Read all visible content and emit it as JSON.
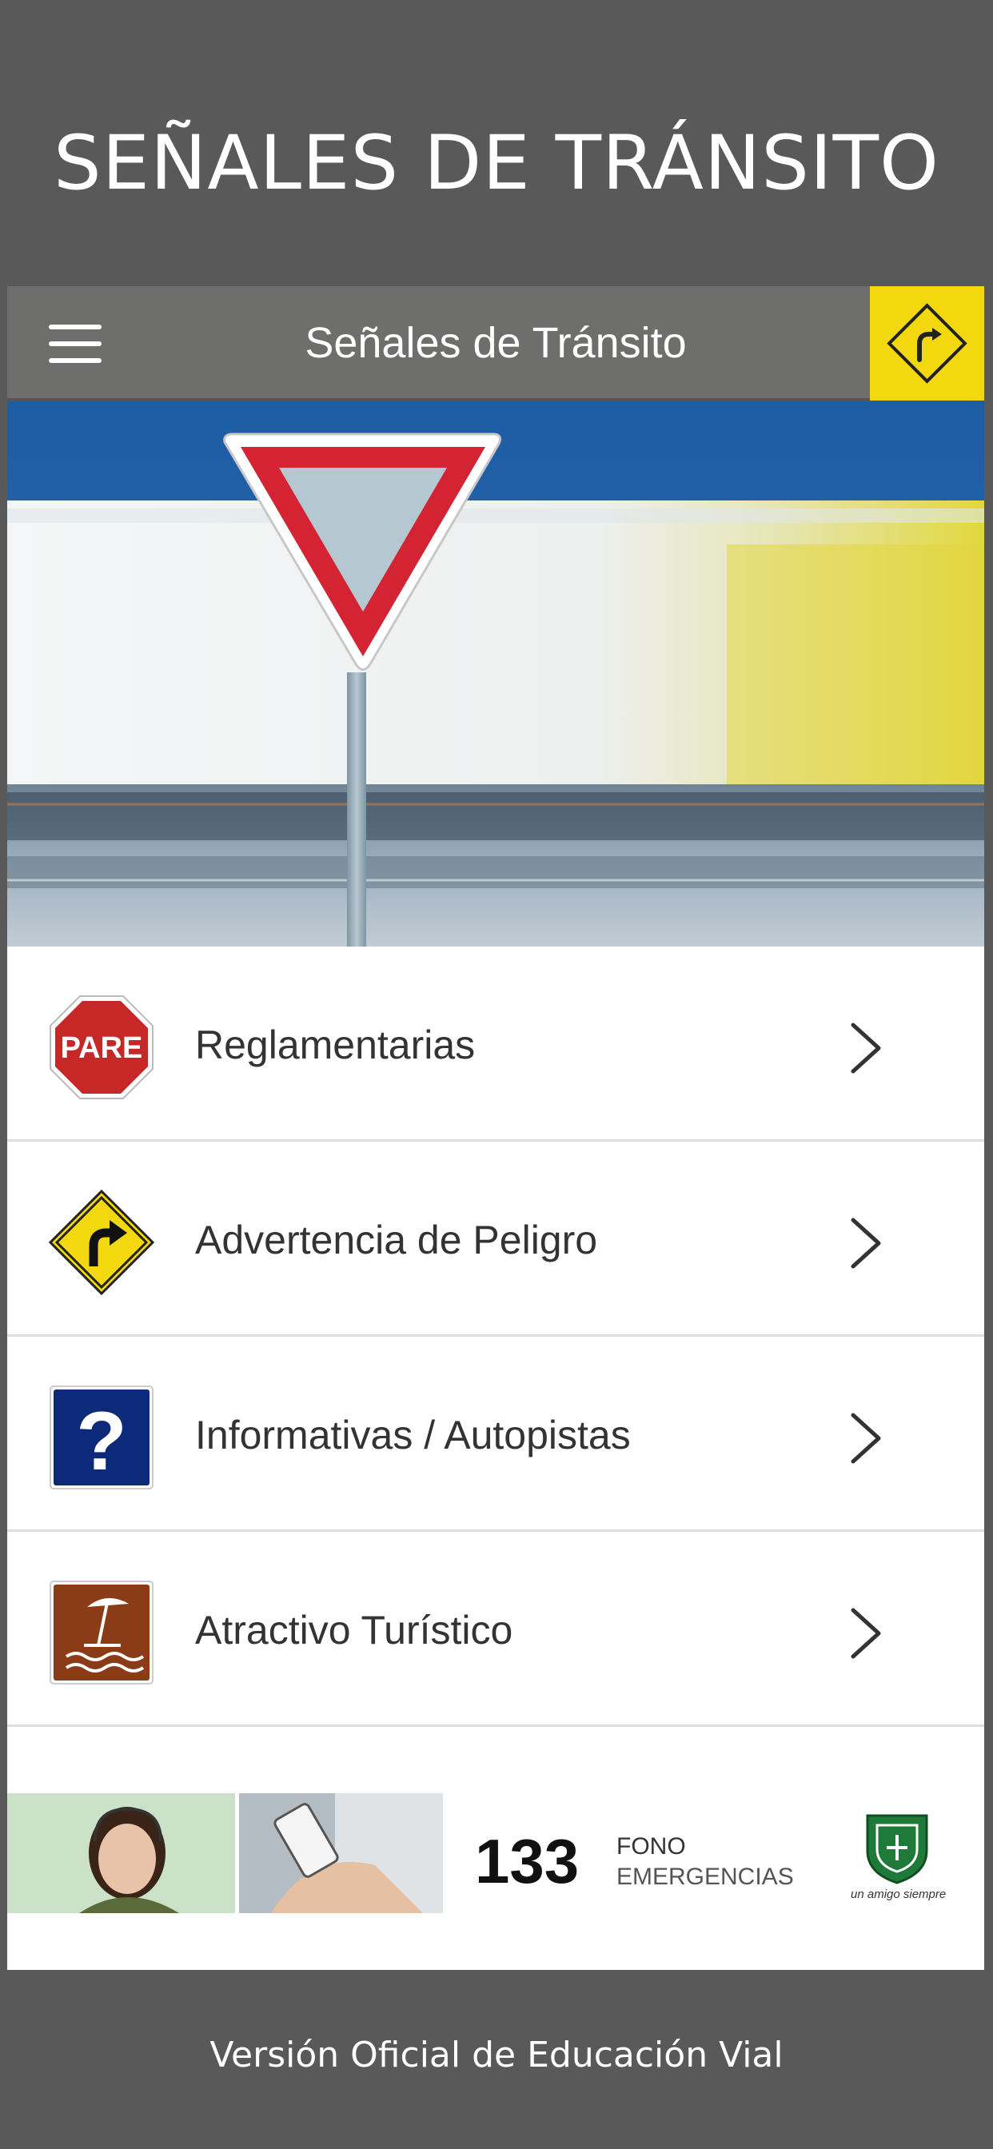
{
  "promo": {
    "headline": "SEÑALES DE TRÁNSITO",
    "footer": "Versión Oficial de Educación Vial"
  },
  "appbar": {
    "title": "Señales de Tránsito",
    "menu_icon": "hamburger-menu-icon",
    "logo_icon": "warning-curve-right-sign-icon",
    "logo_color": "#f3d70f"
  },
  "menu": {
    "items": [
      {
        "label": "Reglamentarias",
        "icon": "stop-sign-icon",
        "icon_text": "PARE"
      },
      {
        "label": "Advertencia de Peligro",
        "icon": "warning-curve-sign-icon"
      },
      {
        "label": "Informativas / Autopistas",
        "icon": "information-question-sign-icon",
        "icon_text": "?"
      },
      {
        "label": "Atractivo Turístico",
        "icon": "beach-umbrella-sign-icon"
      }
    ]
  },
  "banner": {
    "number": "133",
    "fono": "FONO",
    "emergencias": "EMERGENCIAS",
    "slogan": "un amigo siempre"
  },
  "colors": {
    "background": "#595959",
    "appbar": "#6e6e6c",
    "accent_yellow": "#f3d70f",
    "stop_red": "#c62828",
    "info_blue": "#0d2a7a",
    "tourist_brown": "#8b3c17"
  }
}
